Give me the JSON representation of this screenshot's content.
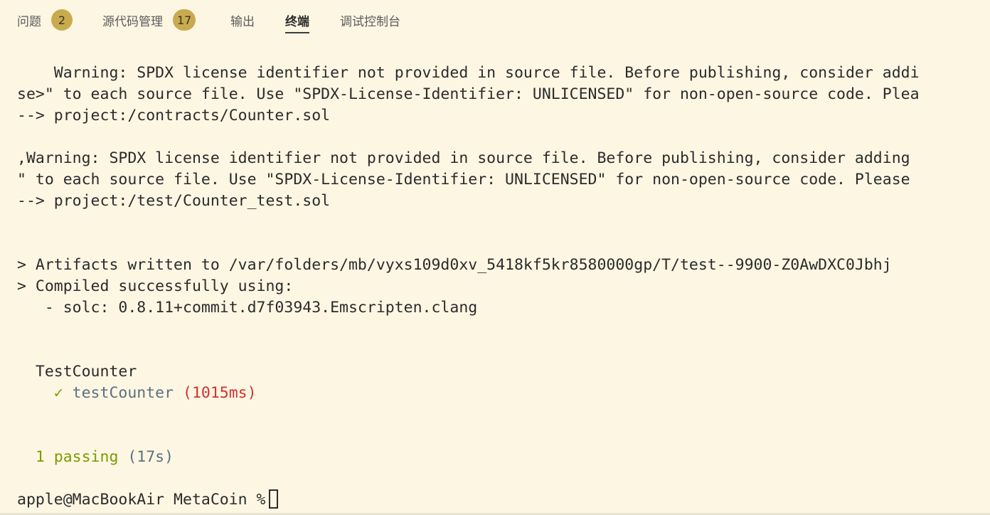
{
  "tabs": {
    "problems": {
      "label": "问题",
      "badge": "2"
    },
    "scm": {
      "label": "源代码管理",
      "badge": "17"
    },
    "output": {
      "label": "输出"
    },
    "terminal": {
      "label": "终端"
    },
    "debug": {
      "label": "调试控制台"
    }
  },
  "terminal": {
    "line1": "    Warning: SPDX license identifier not provided in source file. Before publishing, consider addi",
    "line2": "se>\" to each source file. Use \"SPDX-License-Identifier: UNLICENSED\" for non-open-source code. Plea",
    "line3": "--> project:/contracts/Counter.sol",
    "line4": ",Warning: SPDX license identifier not provided in source file. Before publishing, consider adding",
    "line5": "\" to each source file. Use \"SPDX-License-Identifier: UNLICENSED\" for non-open-source code. Please",
    "line6": "--> project:/test/Counter_test.sol",
    "line7": "> Artifacts written to /var/folders/mb/vyxs109d0xv_5418kf5kr8580000gp/T/test--9900-Z0AwDXC0Jbhj",
    "line8": "> Compiled successfully using:",
    "line9": "   - solc: 0.8.11+commit.d7f03943.Emscripten.clang",
    "suite_name": "  TestCounter",
    "test_check": "    ✓ ",
    "test_name": "testCounter",
    "test_time": " (1015ms)",
    "passing_label": "  1 passing",
    "passing_time": " (17s)",
    "prompt": "apple@MacBookAir MetaCoin %"
  }
}
